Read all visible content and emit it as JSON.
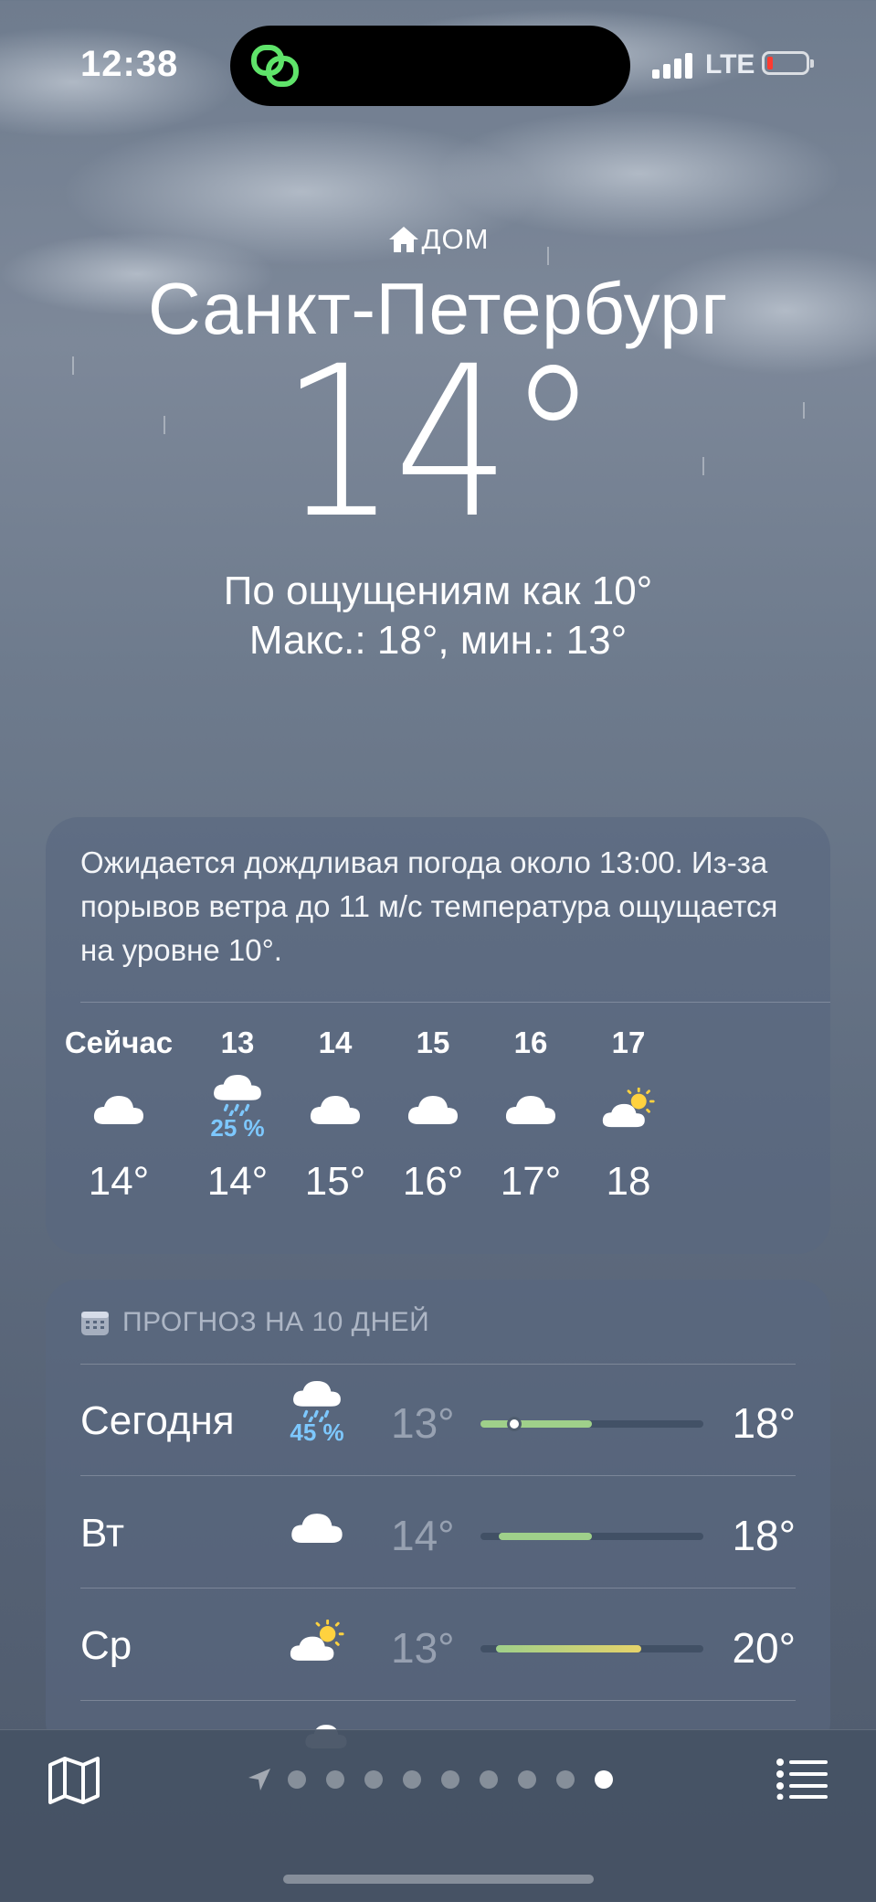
{
  "status_bar": {
    "time": "12:38",
    "network": "LTE",
    "battery_level": 0.1,
    "battery_color": "#ff3b30",
    "island_icon": "linked-circles-icon"
  },
  "location": {
    "home_label": "ДОМ",
    "city": "Санкт-Петербург",
    "temperature": "14°",
    "feels_like": "По ощущениям как 10°",
    "high_low": "Макс.: 18°, мин.: 13°"
  },
  "hourly_card": {
    "summary": "Ожидается дождливая погода около 13:00. Из-за порывов ветра до 11 м/с температура ощущается на уровне 10°.",
    "hours": [
      {
        "label": "Сейчас",
        "icon": "cloud-icon",
        "precip": "",
        "temp": "14°"
      },
      {
        "label": "13",
        "icon": "cloud-rain-icon",
        "precip": "25 %",
        "temp": "14°"
      },
      {
        "label": "14",
        "icon": "cloud-icon",
        "precip": "",
        "temp": "15°"
      },
      {
        "label": "15",
        "icon": "cloud-icon",
        "precip": "",
        "temp": "16°"
      },
      {
        "label": "16",
        "icon": "cloud-icon",
        "precip": "",
        "temp": "17°"
      },
      {
        "label": "17",
        "icon": "cloud-sun-icon",
        "precip": "",
        "temp": "18"
      }
    ]
  },
  "daily_card": {
    "title": "ПРОГНОЗ НА 10 ДНЕЙ",
    "days": [
      {
        "day": "Сегодня",
        "icon": "cloud-rain-icon",
        "precip": "45 %",
        "min": "13°",
        "max": "18°",
        "range_start": 0.0,
        "range_end": 0.5,
        "current": 0.15
      },
      {
        "day": "Вт",
        "icon": "cloud-icon",
        "precip": "",
        "min": "14°",
        "max": "18°",
        "range_start": 0.08,
        "range_end": 0.5
      },
      {
        "day": "Ср",
        "icon": "cloud-sun-icon",
        "precip": "",
        "min": "13°",
        "max": "20°",
        "range_start": 0.07,
        "range_end": 0.72
      }
    ],
    "bar_color_cool": "#9fd08a",
    "bar_color_warm": "#e6d36a"
  },
  "bottom_bar": {
    "map_icon": "map-icon",
    "location_icon": "location-arrow-icon",
    "page_count": 9,
    "active_page": 8,
    "list_icon": "list-icon"
  },
  "colors": {
    "precip_blue": "#7dc8ff"
  }
}
